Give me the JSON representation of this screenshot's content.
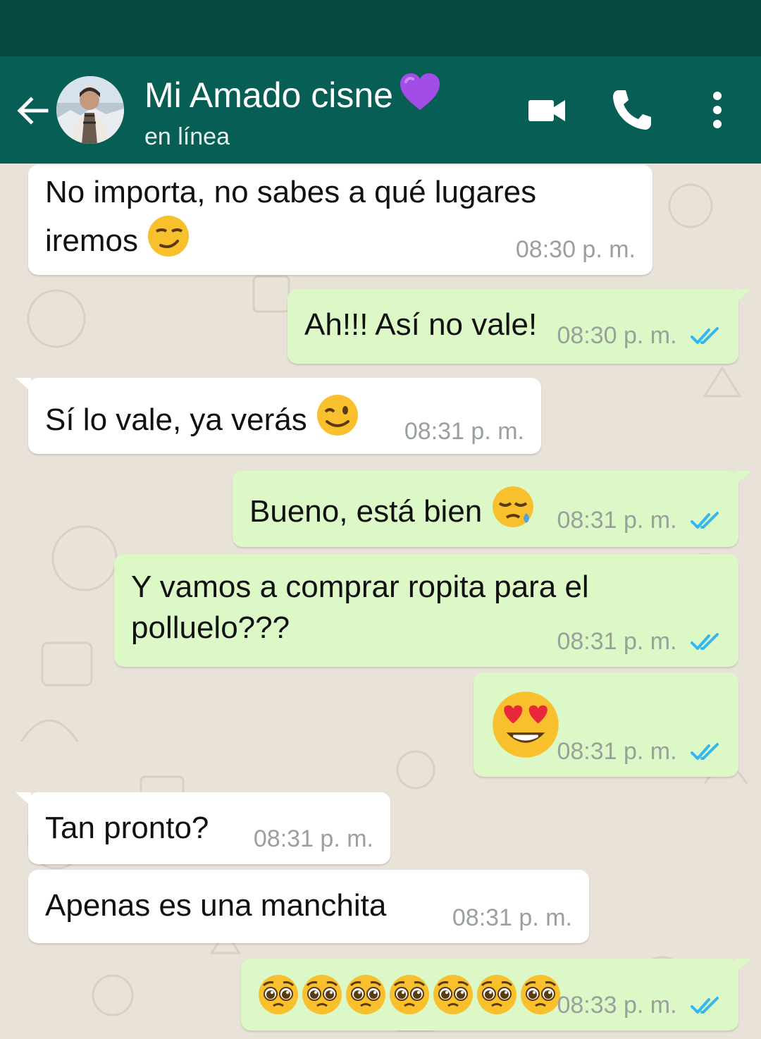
{
  "header": {
    "title": "Mi Amado cisne",
    "status": "en línea"
  },
  "icons": {
    "back": "arrow-left-icon",
    "avatar": "contact-avatar",
    "title_emoji": "purple-heart-icon",
    "video": "video-call-icon",
    "voice": "phone-icon",
    "menu": "more-vertical-icon",
    "read_receipt": "double-check-icon"
  },
  "colors": {
    "status_bar": "#054a41",
    "app_bar": "#075e54",
    "incoming_bubble": "#ffffff",
    "outgoing_bubble": "#dcf8c6",
    "read_ticks": "#34b7f1",
    "timestamp": "#9aa09c"
  },
  "messages": [
    {
      "direction": "in",
      "text_line1": "No importa, no sabes a qué lugares",
      "text_line2": "iremos",
      "emoji": "smirking-face",
      "time": "08:30 p. m."
    },
    {
      "direction": "out",
      "text": "Ah!!! Así no vale!",
      "time": "08:30 p. m.",
      "read": true
    },
    {
      "direction": "in",
      "text": "Sí lo vale, ya verás",
      "emoji": "winking-face",
      "time": "08:31 p. m."
    },
    {
      "direction": "out",
      "text": "Bueno, está bien",
      "emoji": "sleepy-face",
      "time": "08:31 p. m.",
      "read": true
    },
    {
      "direction": "out",
      "text_line1": "Y vamos a comprar ropita para el",
      "text_line2": "polluelo???",
      "time": "08:31 p. m.",
      "read": true
    },
    {
      "direction": "out",
      "emoji": "heart-eyes-face",
      "time": "08:31 p. m.",
      "read": true
    },
    {
      "direction": "in",
      "text": "Tan pronto?",
      "time": "08:31 p. m."
    },
    {
      "direction": "in",
      "text": "Apenas es una manchita",
      "time": "08:31 p. m."
    },
    {
      "direction": "out",
      "emoji": "pleading-face",
      "emoji_count": 7,
      "time": "08:33 p. m.",
      "read": true
    }
  ]
}
